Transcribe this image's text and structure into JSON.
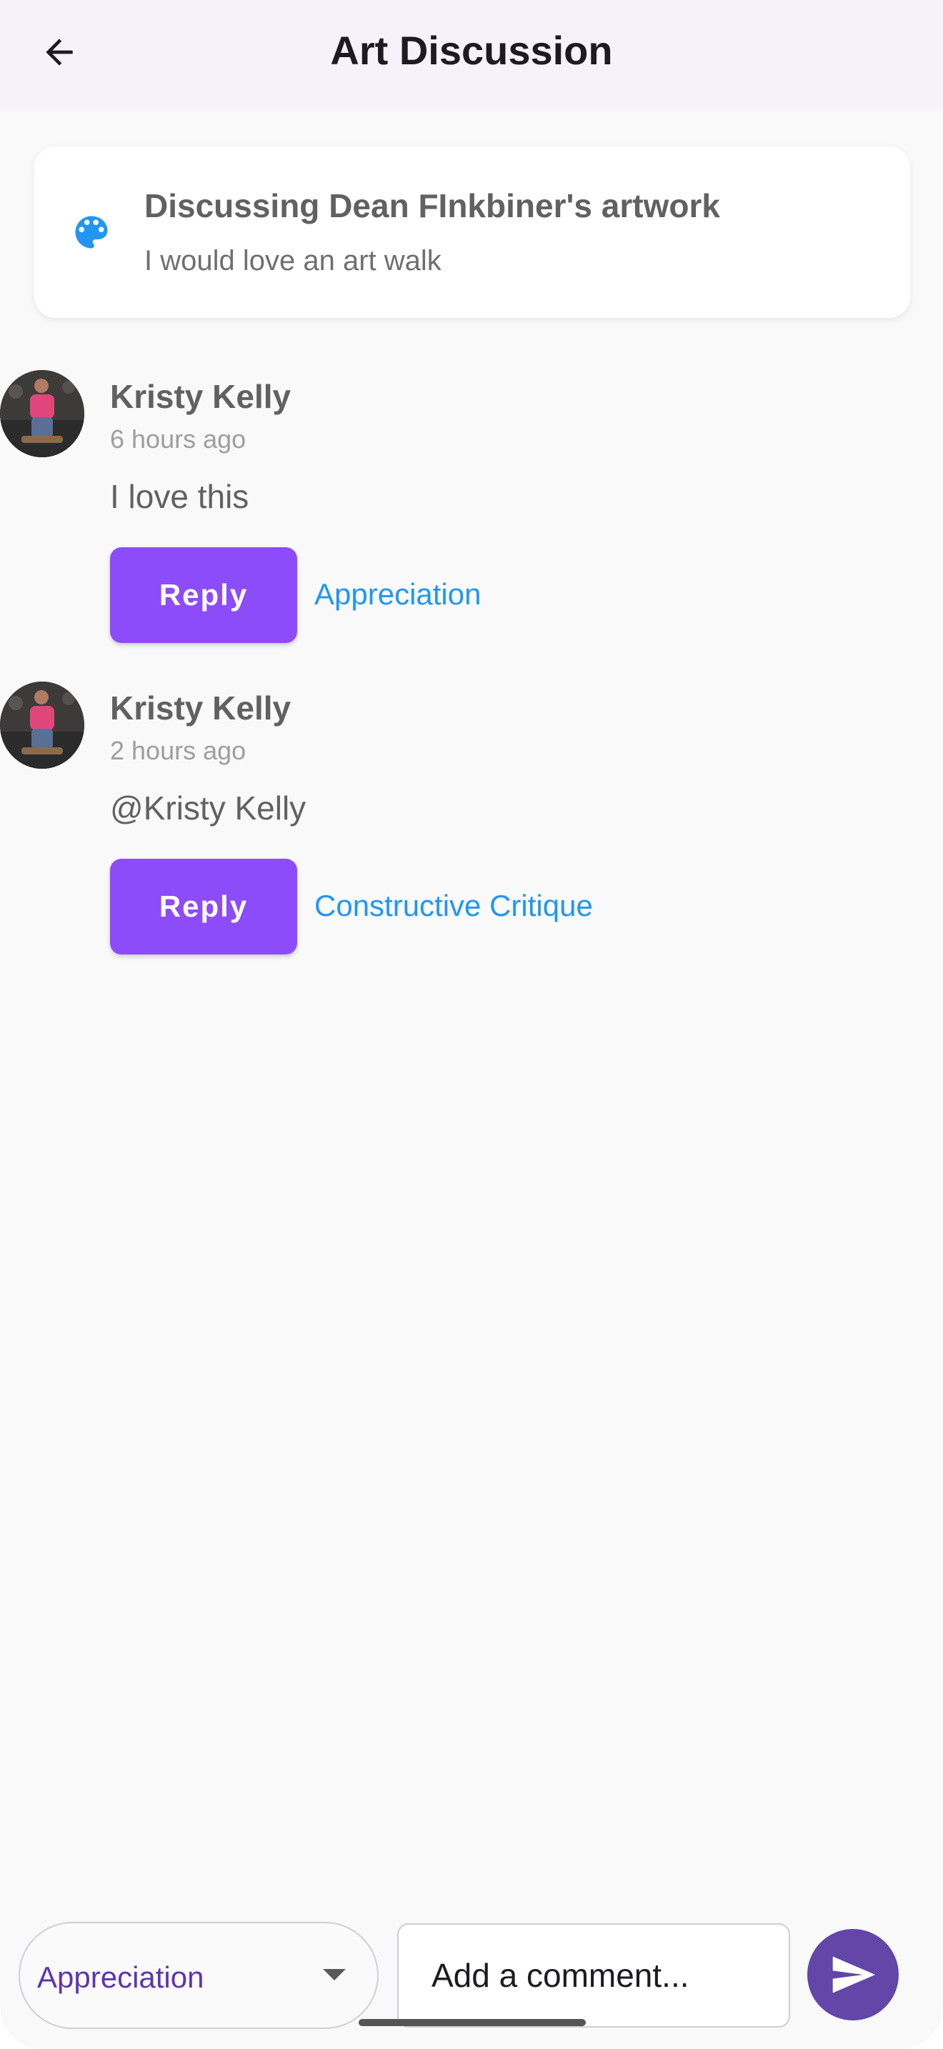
{
  "app_bar": {
    "title": "Art Discussion",
    "back_icon": "arrow-left-icon"
  },
  "topic": {
    "icon": "palette-icon",
    "title": "Discussing Dean FInkbiner's artwork",
    "subtitle": "I would love an art walk",
    "accent_color": "#2196f3"
  },
  "comments": [
    {
      "author": "Kristy Kelly",
      "time": "6 hours ago",
      "text": "I love this",
      "reply_label": "Reply",
      "category": "Appreciation"
    },
    {
      "author": "Kristy Kelly",
      "time": "2 hours ago",
      "text": "@Kristy Kelly",
      "reply_label": "Reply",
      "category": "Constructive Critique"
    }
  ],
  "composer": {
    "category_selected": "Appreciation",
    "input_placeholder": "Add a comment...",
    "send_icon": "send-icon"
  },
  "colors": {
    "reply_button": "#8c4cf9",
    "category_link": "#2196f3",
    "send_button": "#6346a8",
    "app_bar_bg": "#f6f2fc"
  }
}
